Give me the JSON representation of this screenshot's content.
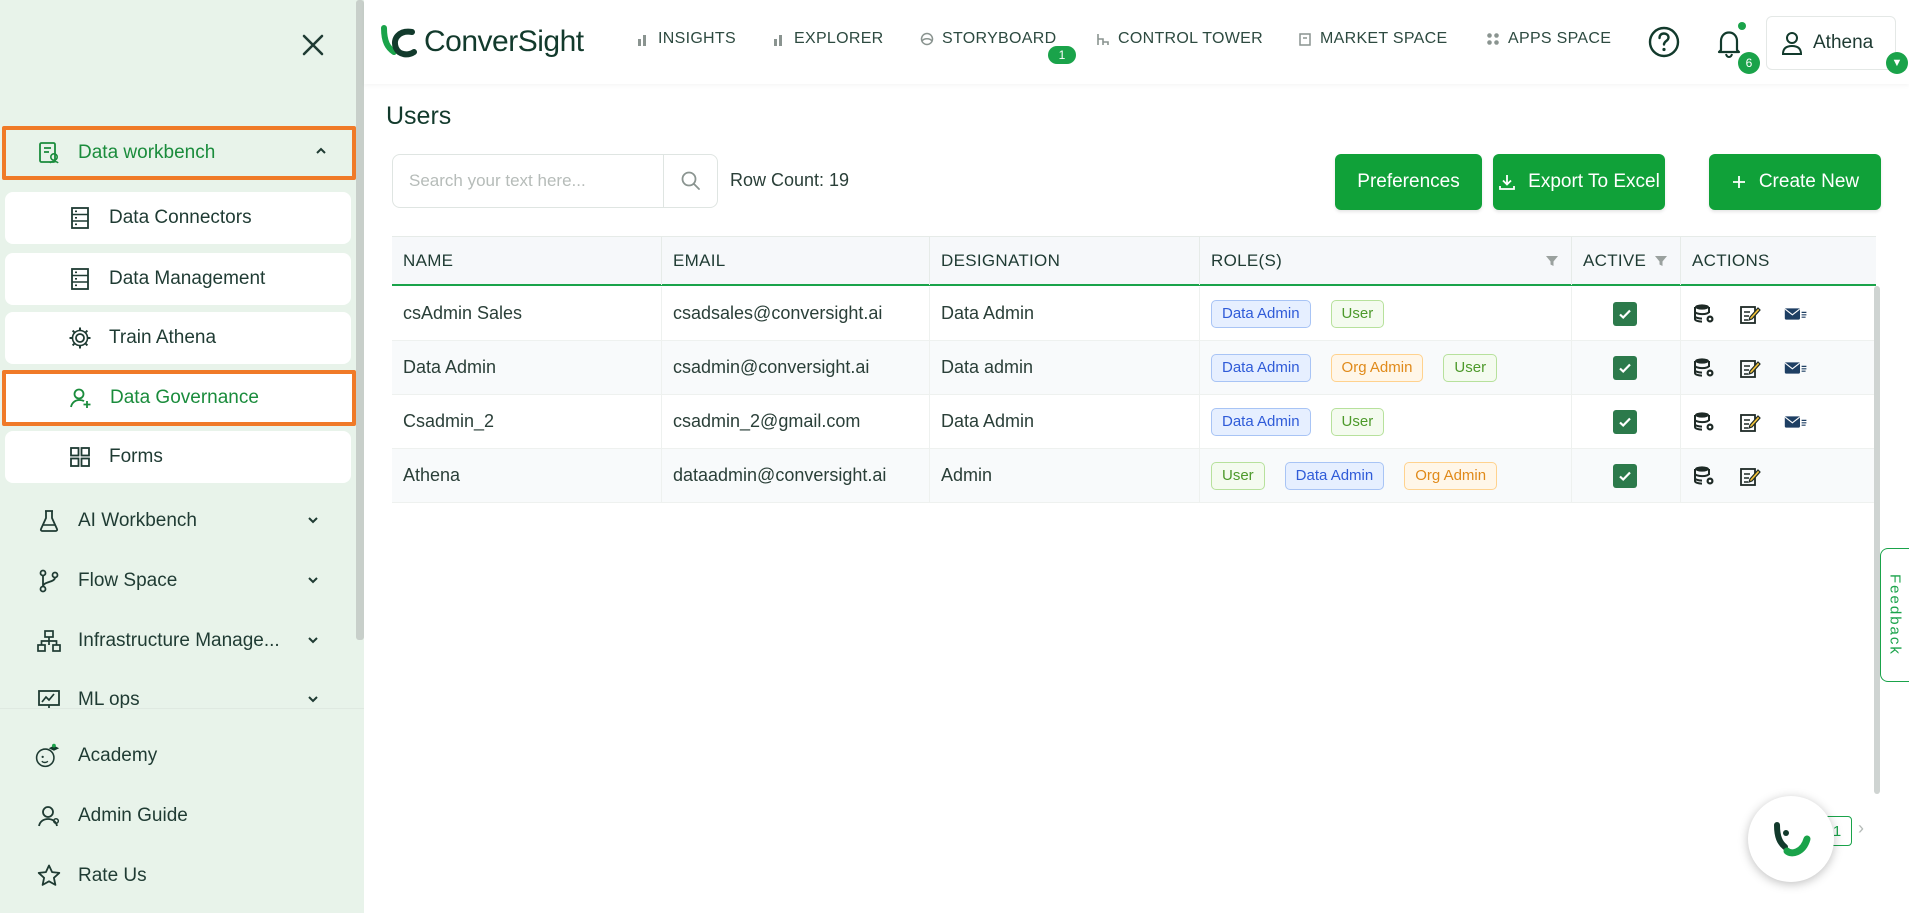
{
  "sidebar": {
    "group": {
      "label": "Data workbench"
    },
    "sub_items": [
      {
        "label": "Data Connectors"
      },
      {
        "label": "Data Management"
      },
      {
        "label": "Train Athena"
      },
      {
        "label": "Data Governance"
      },
      {
        "label": "Forms"
      }
    ],
    "items": [
      {
        "label": "AI Workbench"
      },
      {
        "label": "Flow Space"
      },
      {
        "label": "Infrastructure Manage..."
      },
      {
        "label": "ML ops"
      }
    ],
    "bottom": [
      {
        "label": "Academy"
      },
      {
        "label": "Admin Guide"
      },
      {
        "label": "Rate Us"
      }
    ]
  },
  "header": {
    "logo_text": "ConverSight",
    "nav": [
      {
        "label": "INSIGHTS"
      },
      {
        "label": "EXPLORER"
      },
      {
        "label": "STORYBOARD"
      },
      {
        "label": "CONTROL TOWER"
      },
      {
        "label": "MARKET SPACE"
      },
      {
        "label": "APPS SPACE"
      }
    ],
    "storyboard_badge": "1",
    "notification_count": "6",
    "user_name": "Athena"
  },
  "main": {
    "title": "Users",
    "search_placeholder": "Search your text here...",
    "row_count": "Row Count: 19",
    "buttons": {
      "preferences": "Preferences",
      "export": "Export To Excel",
      "create": "Create New"
    },
    "columns": {
      "name": "NAME",
      "email": "EMAIL",
      "designation": "DESIGNATION",
      "roles": "ROLE(S)",
      "active": "ACTIVE",
      "actions": "ACTIONS"
    },
    "rows": [
      {
        "name": "csAdmin Sales",
        "email": "csadsales@conversight.ai",
        "designation": "Data Admin",
        "roles": [
          {
            "label": "Data Admin",
            "color": "blue"
          },
          {
            "label": "User",
            "color": "green"
          }
        ],
        "active": true,
        "mail": true
      },
      {
        "name": "Data Admin",
        "email": "csadmin@conversight.ai",
        "designation": "Data admin",
        "roles": [
          {
            "label": "Data Admin",
            "color": "blue"
          },
          {
            "label": "Org Admin",
            "color": "orange"
          },
          {
            "label": "User",
            "color": "green"
          }
        ],
        "active": true,
        "mail": true
      },
      {
        "name": "Csadmin_2",
        "email": "csadmin_2@gmail.com",
        "designation": "Data Admin",
        "roles": [
          {
            "label": "Data Admin",
            "color": "blue"
          },
          {
            "label": "User",
            "color": "green"
          }
        ],
        "active": true,
        "mail": true
      },
      {
        "name": "Athena",
        "email": "dataadmin@conversight.ai",
        "designation": "Admin",
        "roles": [
          {
            "label": "User",
            "color": "green"
          },
          {
            "label": "Data Admin",
            "color": "blue"
          },
          {
            "label": "Org Admin",
            "color": "orange"
          }
        ],
        "active": true,
        "mail": false
      }
    ],
    "page_number": "1",
    "feedback_label": "Feedback"
  },
  "colors": {
    "accent": "#10a139",
    "highlight_border": "#f07a28",
    "sidebar_bg": "#e8f3ea"
  },
  "icons": {
    "close": "close-icon",
    "search": "search-icon",
    "help": "help-icon",
    "bell": "bell-icon",
    "user": "user-icon"
  }
}
